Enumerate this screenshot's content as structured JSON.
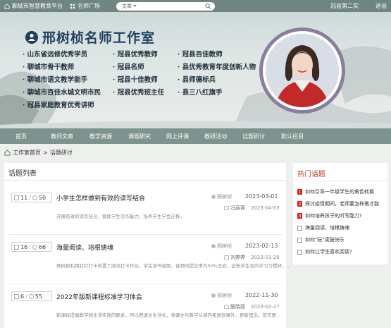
{
  "topbar": {
    "site_name": "聊城市智慧教育平台",
    "plaza": "名师广场",
    "search_type": "文章",
    "search_placeholder": "",
    "user": "冠县第二实",
    "exit": "退出"
  },
  "banner": {
    "title": "邢树桢名师工作室",
    "honors": [
      "山东省远修优秀学员",
      "冠县优秀教师",
      "冠县百佳教师",
      "聊城市骨干教师",
      "冠县名师",
      "县优秀教育年度创新人物",
      "聊城市语文教学能手",
      "冠县十佳教师",
      "县师德标兵",
      "聊城市百佳水城文明市民",
      "冠县优秀班主任",
      "县三八红旗手",
      "冠县家庭教育优秀讲师"
    ]
  },
  "nav": [
    "首页",
    "教师文章",
    "教学资源",
    "课题研究",
    "网上评课",
    "教研活动",
    "话题研讨",
    "默认栏目"
  ],
  "breadcrumb": {
    "home": "工作室首页",
    "sep": ">",
    "current": "话题研讨"
  },
  "topic_list": {
    "title": "话题列表",
    "items": [
      {
        "replies": "11",
        "views": "50",
        "title": "小学生怎样做到有效的读写结合",
        "desc": "开展有效的读写结合，锻炼学生写作能力，培养学生学会迁移。",
        "author": "邢树桢",
        "date": "2023-03-01",
        "last_reply_by": "冯丽蓉",
        "last_reply_date": "2023-04-03"
      },
      {
        "replies": "16",
        "views": "66",
        "title": "海量阅读、培根铸魂",
        "desc": "邢树桢利用钉钉打卡布置了阅读打卡作业，学生读书视频、音频的提交率为50%左右，这些学生有的学习习惯好，...",
        "author": "邢树桢",
        "date": "2023-02-13",
        "last_reply_by": "刘婷婷",
        "last_reply_date": "2023-03-26"
      },
      {
        "replies": "6",
        "views": "55",
        "title": "2022年版新课程标准学习体会",
        "desc": "新课标提倡教学和生活实践的联系，可以把语文生活化，将课文与教学从课内拓展到课外，更新理念。首先要...",
        "author": "邢树桢",
        "date": "2022-11-30",
        "last_reply_by": "殷晓丽",
        "last_reply_date": "2023-02-27"
      }
    ]
  },
  "hot_topics": {
    "title": "热门话题",
    "items": [
      {
        "rank": "1",
        "text": "如何引导一年级学生的角色转换"
      },
      {
        "rank": "2",
        "text": "探讨疫情期间，老师要怎样做才能"
      },
      {
        "rank": "3",
        "text": "如何培养孩子的听写能力?"
      },
      {
        "rank": "",
        "text": "海量阅读、培根铸魂"
      },
      {
        "rank": "",
        "text": "如何\"玩\"读鼓快乐"
      },
      {
        "rank": "",
        "text": "如何让学生喜欢阅读?"
      }
    ]
  }
}
